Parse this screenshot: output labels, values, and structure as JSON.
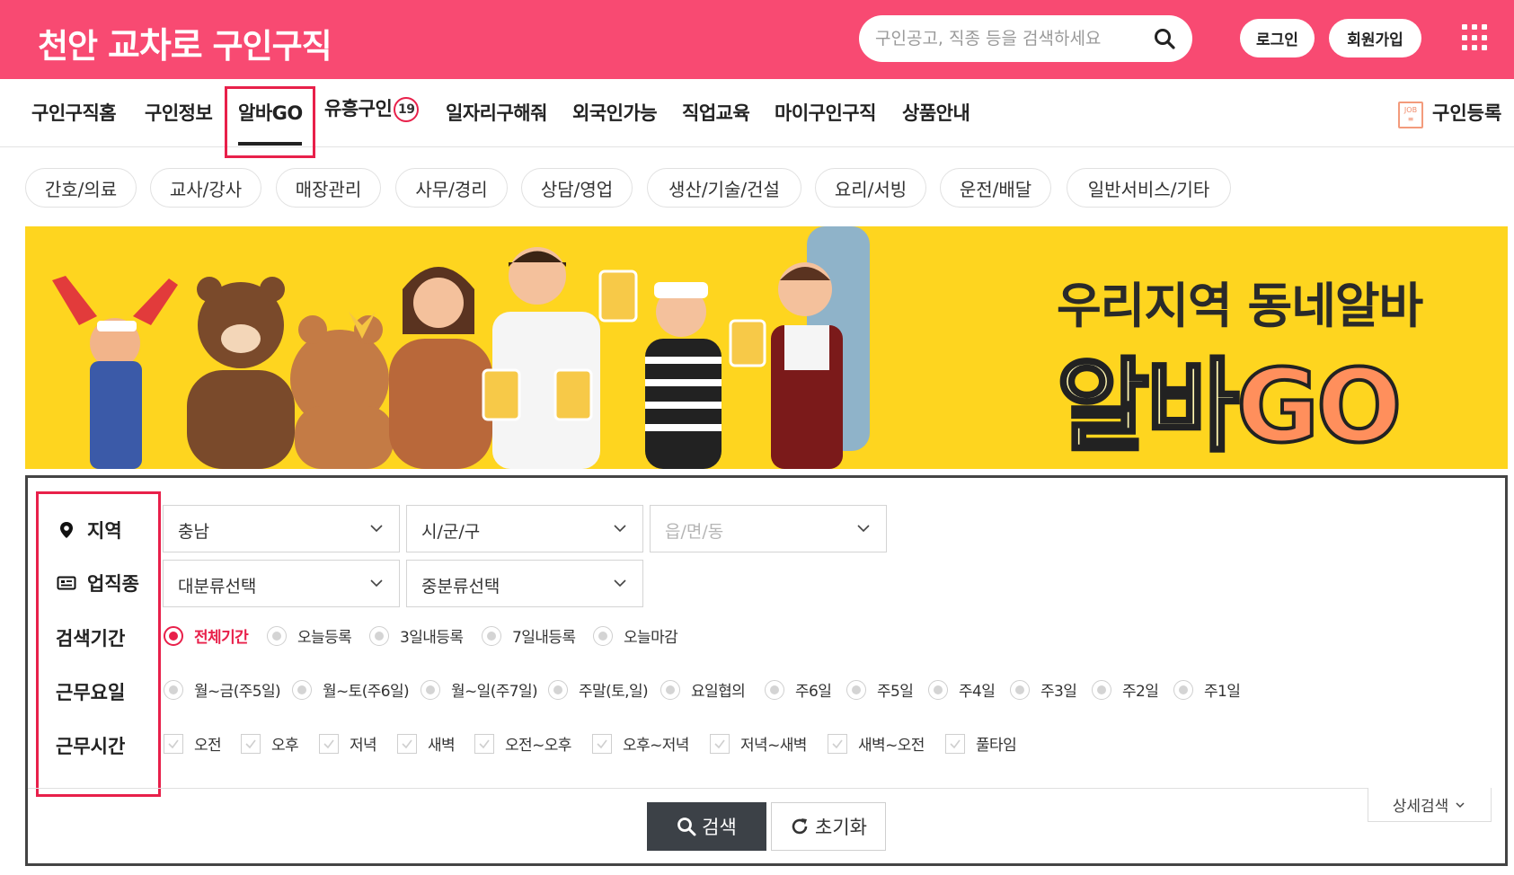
{
  "header": {
    "logo_part1": "천안",
    "logo_part2": "교차로",
    "logo_part3": "구인구직",
    "search_placeholder": "구인공고, 직종 등을 검색하세요",
    "login_label": "로그인",
    "join_label": "회원가입",
    "brand_color": "#f84a72"
  },
  "nav": {
    "items": [
      "구인구직홈",
      "구인정보",
      "알바GO",
      "유흥구인",
      "일자리구해줘",
      "외국인가능",
      "직업교육",
      "마이구인구직",
      "상품안내"
    ],
    "badge": "19",
    "active": "알바GO",
    "register_icon_text": "JOB",
    "register_label": "구인등록"
  },
  "categories": [
    "간호/의료",
    "교사/강사",
    "매장관리",
    "사무/경리",
    "상담/영업",
    "생산/기술/건설",
    "요리/서빙",
    "운전/배달",
    "일반서비스/기타"
  ],
  "banner": {
    "line1": "우리지역 동네알바",
    "line2_part1": "알바",
    "line2_part2": "GO",
    "background": "#fed51f"
  },
  "filters": {
    "labels": {
      "region": "지역",
      "job": "업직종",
      "period": "검색기간",
      "workdays": "근무요일",
      "worktime": "근무시간"
    },
    "region_selects": [
      "충남",
      "시/군/구",
      "읍/면/동"
    ],
    "job_selects": [
      "대분류선택",
      "중분류선택"
    ],
    "period_options": [
      "전체기간",
      "오늘등록",
      "3일내등록",
      "7일내등록",
      "오늘마감"
    ],
    "period_selected": "전체기간",
    "workday_options": [
      "월~금(주5일)",
      "월~토(주6일)",
      "월~일(주7일)",
      "주말(토,일)",
      "요일협의",
      "주6일",
      "주5일",
      "주4일",
      "주3일",
      "주2일",
      "주1일"
    ],
    "worktime_options": [
      "오전",
      "오후",
      "저녁",
      "새벽",
      "오전~오후",
      "오후~저녁",
      "저녁~새벽",
      "새벽~오전",
      "풀타임"
    ],
    "detail_label": "상세검색",
    "search_label": "검색",
    "reset_label": "초기화",
    "accent_color": "#e8204a"
  }
}
